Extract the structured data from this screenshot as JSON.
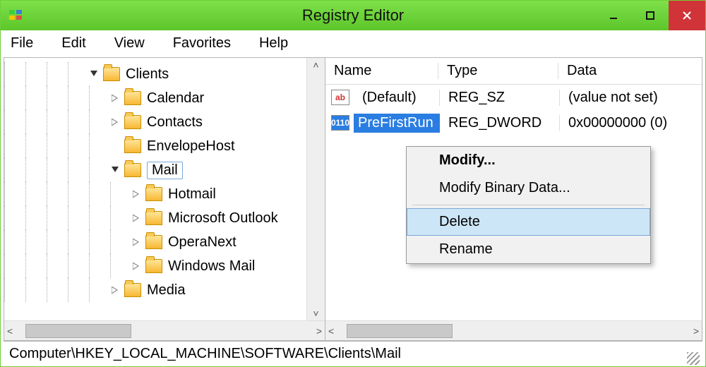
{
  "title": "Registry Editor",
  "menu": {
    "file": "File",
    "edit": "Edit",
    "view": "View",
    "favorites": "Favorites",
    "help": "Help"
  },
  "tree": {
    "clients": "Clients",
    "calendar": "Calendar",
    "contacts": "Contacts",
    "envelope": "EnvelopeHost",
    "mail": "Mail",
    "hotmail": "Hotmail",
    "msoutlook": "Microsoft Outlook",
    "operanext": "OperaNext",
    "winmail": "Windows Mail",
    "media": "Media"
  },
  "columns": {
    "name": "Name",
    "type": "Type",
    "data": "Data"
  },
  "rows": [
    {
      "name": "(Default)",
      "type": "REG_SZ",
      "data": "(value not set)",
      "kind": "sz"
    },
    {
      "name": "PreFirstRun",
      "type": "REG_DWORD",
      "data": "0x00000000 (0)",
      "kind": "dw"
    }
  ],
  "context": {
    "modify": "Modify...",
    "modify_binary": "Modify Binary Data...",
    "delete": "Delete",
    "rename": "Rename"
  },
  "status_path": "Computer\\HKEY_LOCAL_MACHINE\\SOFTWARE\\Clients\\Mail",
  "icons": {
    "ab": "ab",
    "dw": "0110"
  }
}
